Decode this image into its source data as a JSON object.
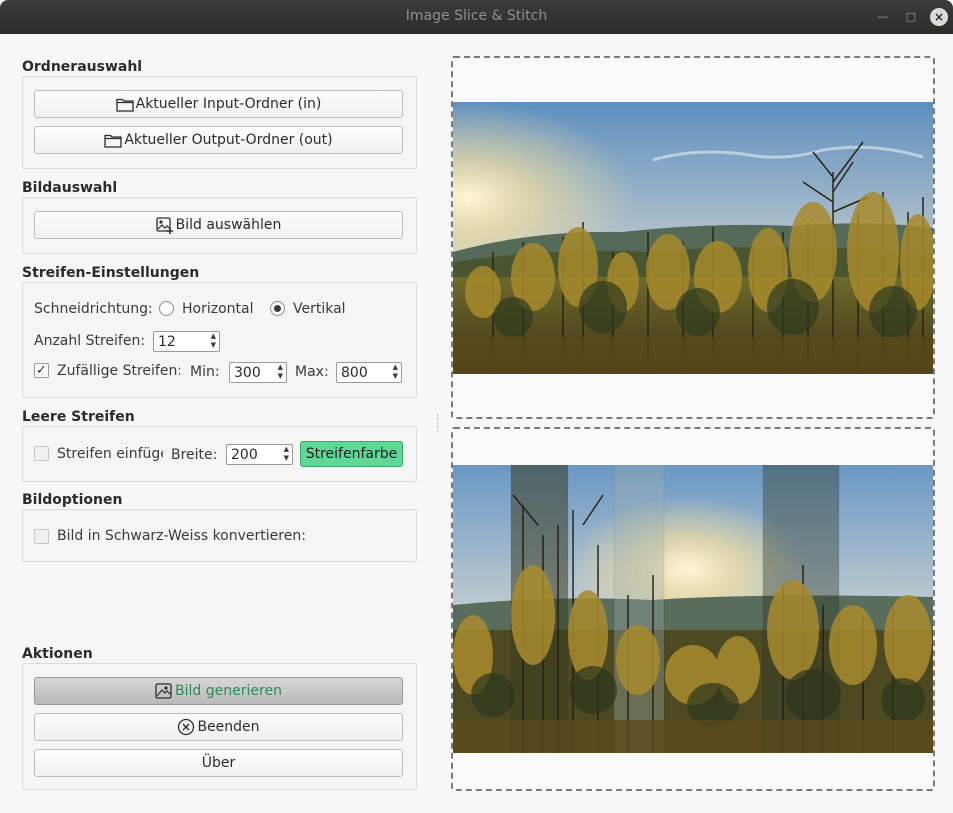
{
  "window": {
    "title": "Image Slice & Stitch"
  },
  "sections": {
    "folder": {
      "label": "Ordnerauswahl",
      "input_button": "Aktueller Input-Ordner (in)",
      "output_button": "Aktueller Output-Ordner (out)"
    },
    "image": {
      "label": "Bildauswahl",
      "select_button": "Bild auswählen"
    },
    "strips": {
      "label": "Streifen-Einstellungen",
      "direction_label": "Schneidrichtung:",
      "horizontal_label": "Horizontal",
      "vertical_label": "Vertikal",
      "selected_direction": "Vertikal",
      "count_label": "Anzahl Streifen:",
      "count_value": "12",
      "random_label": "Zufällige Streifen:",
      "random_checked": true,
      "min_label": "Min:",
      "min_value": "300",
      "max_label": "Max:",
      "max_value": "800"
    },
    "empty_strips": {
      "label": "Leere Streifen",
      "insert_label": "Streifen einfügen",
      "insert_checked": false,
      "width_label": "Breite:",
      "width_value": "200",
      "color_button": "Streifenfarbe",
      "color": "#5fd897"
    },
    "image_options": {
      "label": "Bildoptionen",
      "grayscale_label": "Bild in Schwarz-Weiss konvertieren:",
      "grayscale_checked": false
    },
    "actions": {
      "label": "Aktionen",
      "generate_button": "Bild generieren",
      "quit_button": "Beenden",
      "about_button": "Über"
    }
  },
  "icons": {
    "folder": "folder-icon",
    "image_select": "image-add-icon",
    "generate": "image-icon",
    "quit": "close-circle-icon"
  },
  "colors": {
    "accent": "#2e8b57",
    "strip_color": "#5fd897"
  }
}
